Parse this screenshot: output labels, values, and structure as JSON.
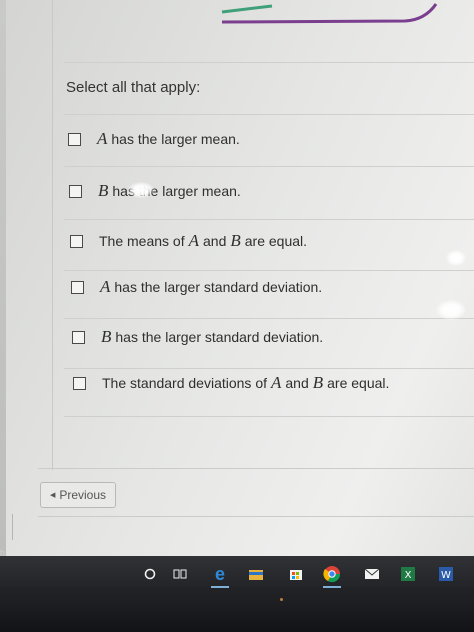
{
  "question": {
    "prompt": "Select all that apply:",
    "options": [
      {
        "var": "A",
        "text": "has the larger mean."
      },
      {
        "var": "B",
        "text": "has the larger mean."
      },
      {
        "pre": "The means of",
        "var1": "A",
        "mid": "and",
        "var2": "B",
        "post": "are equal."
      },
      {
        "var": "A",
        "text": "has the larger standard deviation."
      },
      {
        "var": "B",
        "text": "has the larger standard deviation."
      },
      {
        "pre": "The standard deviations of",
        "var1": "A",
        "mid": "and",
        "var2": "B",
        "post": "are equal."
      }
    ]
  },
  "navigation": {
    "previous_label": "Previous"
  },
  "taskbar": {
    "search_stub": "h",
    "icons": [
      "cortana-circle-icon",
      "task-view-icon",
      "edge-icon",
      "file-explorer-icon",
      "store-icon",
      "chrome-icon",
      "mail-icon",
      "excel-icon",
      "word-icon"
    ]
  },
  "colors": {
    "graph_green": "#3fa07a",
    "graph_purple": "#7a3f8e",
    "checkbox_border": "#4a4a4a"
  }
}
